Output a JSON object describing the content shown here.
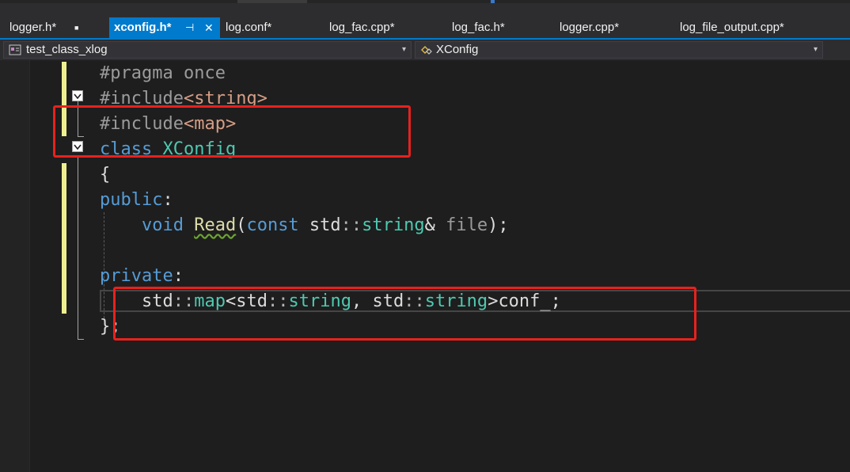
{
  "tabs": [
    {
      "label": "logger.h*",
      "icon": "pin-icon"
    },
    {
      "label": "xconfig.h*",
      "icon": "pin-icon",
      "active": true
    },
    {
      "label": "log.conf*"
    },
    {
      "label": "log_fac.cpp*"
    },
    {
      "label": "log_fac.h*"
    },
    {
      "label": "logger.cpp*"
    },
    {
      "label": "log_file_output.cpp*"
    }
  ],
  "tab_glyphs": {
    "pin": "■",
    "pin_active": "⊣",
    "close": "✕"
  },
  "navbar": {
    "project": "test_class_xlog",
    "scope": "XConfig",
    "caret": "▾"
  },
  "code": {
    "line1": {
      "t1": "#pragma",
      "t2": " ",
      "t3": "once"
    },
    "line2": {
      "t1": "#include",
      "t2": "<string>"
    },
    "line3": {
      "t1": "#include",
      "t2": "<map>"
    },
    "line4": {
      "t1": "class",
      "t2": " ",
      "t3": "XConfig"
    },
    "line5": {
      "t1": "{"
    },
    "line6": {
      "t1": "public",
      "t2": ":"
    },
    "line7": {
      "t1": "    ",
      "t2": "void",
      "t3": " ",
      "t4": "Read",
      "t5": "(",
      "t6": "const",
      "t7": " std",
      "t8": "::",
      "t9": "string",
      "t10": "&",
      "t11": " ",
      "t12": "file",
      "t13": ");"
    },
    "line8": {
      "t1": ""
    },
    "line9": {
      "t1": "private",
      "t2": ":"
    },
    "line10": {
      "t1": "    std",
      "t2": "::",
      "t3": "map",
      "t4": "<",
      "t5": "std",
      "t6": "::",
      "t7": "string",
      "t8": ", ",
      "t9": "std",
      "t10": "::",
      "t11": "string",
      "t12": ">",
      "t13": "conf_",
      "t14": ";"
    },
    "line11": {
      "t1": "};"
    }
  },
  "colors": {
    "keyword": "#569cd6",
    "type": "#4ec9b0",
    "function": "#dcdcaa",
    "include_path": "#d69d85",
    "preprocessor": "#9b9b9b",
    "accent": "#007acc",
    "highlight_box": "#e8211d"
  }
}
